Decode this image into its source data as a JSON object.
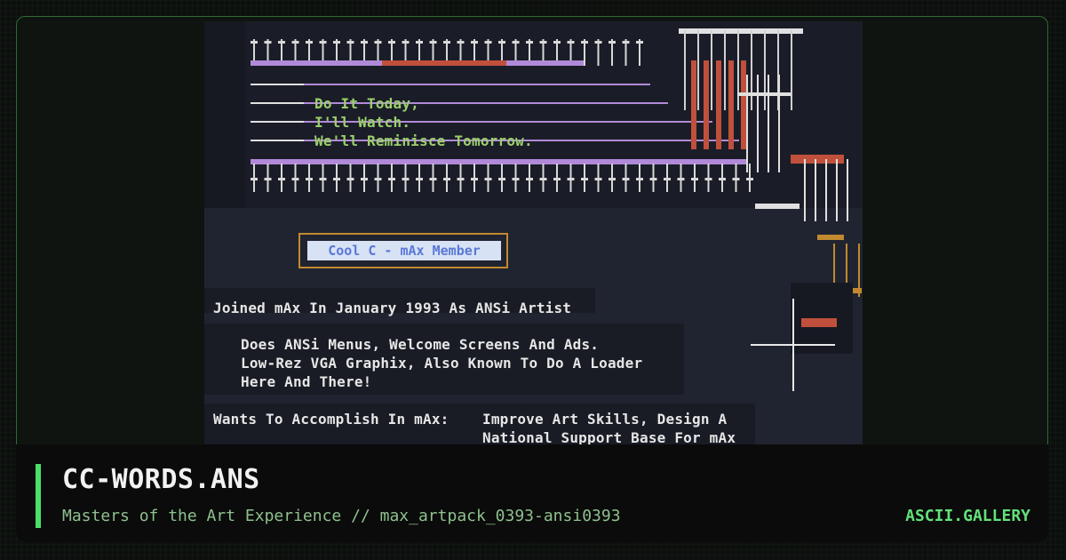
{
  "footer": {
    "title": "CC-WORDS.ANS",
    "subtitle": "Masters of the Art Experience // max_artpack_0393-ansi0393",
    "brand": "ASCII.GALLERY"
  },
  "artwork": {
    "quote_line_1": "Do It Today,",
    "quote_line_2": "I'll Watch.",
    "quote_line_3": "We'll Reminisce Tomorrow.",
    "badge": "Cool C - mAx Member",
    "joined": "Joined mAx In January 1993 As ANSi Artist",
    "does_1": "Does ANSi Menus, Welcome Screens And Ads.",
    "does_2": "Low-Rez VGA Graphix, Also Known To Do A Loader",
    "does_3": "Here And There!",
    "wants_label": "Wants To Accomplish In mAx:",
    "wants_1": "Improve Art Skills, Design A",
    "wants_2": "National Support Base For mAx"
  },
  "colors": {
    "accent": "#4ae06a",
    "art_background": "#202430",
    "purple_line": "#b08ad8",
    "orange_accent": "#c2892f",
    "red_accent": "#c0503c"
  }
}
